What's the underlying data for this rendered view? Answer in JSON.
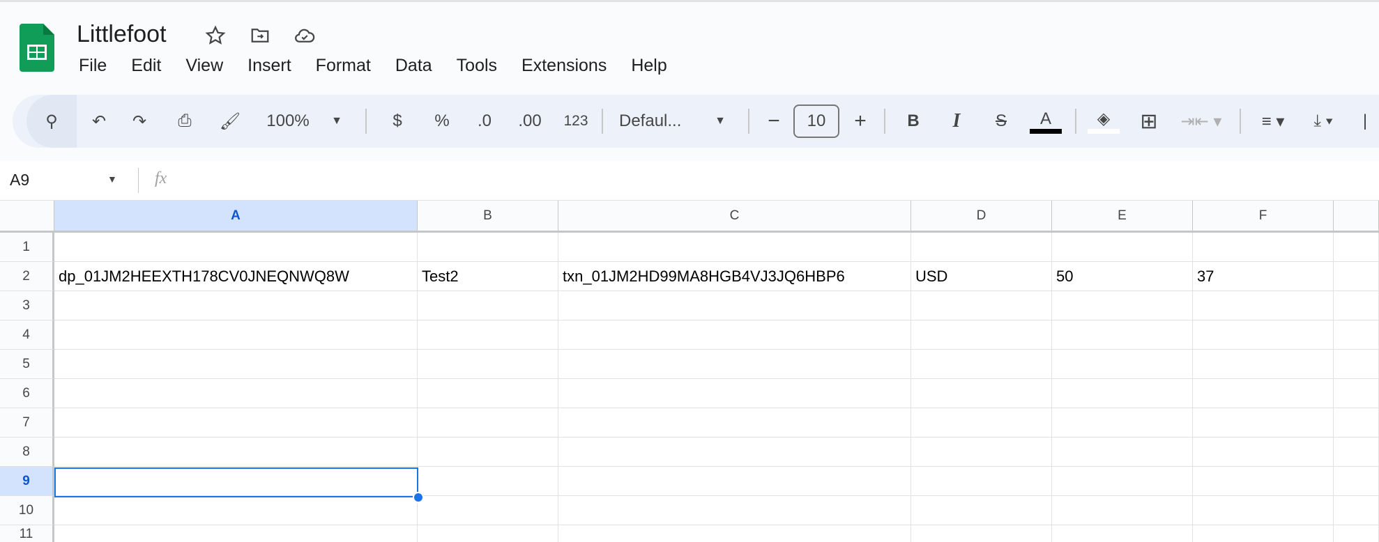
{
  "app": {
    "title": "Littlefoot"
  },
  "menu": [
    "File",
    "Edit",
    "View",
    "Insert",
    "Format",
    "Data",
    "Tools",
    "Extensions",
    "Help"
  ],
  "toolbar": {
    "zoom": "100%",
    "currency": "$",
    "percent": "%",
    "dec_decrease": ".0",
    "dec_increase": ".00",
    "number_format": "123",
    "font": "Defaul...",
    "font_size": "10",
    "bold": "B",
    "italic": "I",
    "text_color": "A"
  },
  "formula_bar": {
    "name_box": "A9",
    "fx": "fx",
    "value": ""
  },
  "grid": {
    "columns": [
      "A",
      "B",
      "C",
      "D",
      "E",
      "F"
    ],
    "rows": [
      "1",
      "2",
      "3",
      "4",
      "5",
      "6",
      "7",
      "8",
      "9",
      "10",
      "11"
    ],
    "selected_cell": "A9",
    "cells": {
      "r2": [
        "dp_01JM2HEEXTH178CV0JNEQNWQ8W",
        "Test2",
        "txn_01JM2HD99MA8HGB4VJ3JQ6HBP6",
        "USD",
        "50",
        "37"
      ]
    }
  },
  "colors": {
    "accent": "#1a73e8",
    "selection_header": "#d3e3fd",
    "sheets_green": "#0f9d58"
  }
}
